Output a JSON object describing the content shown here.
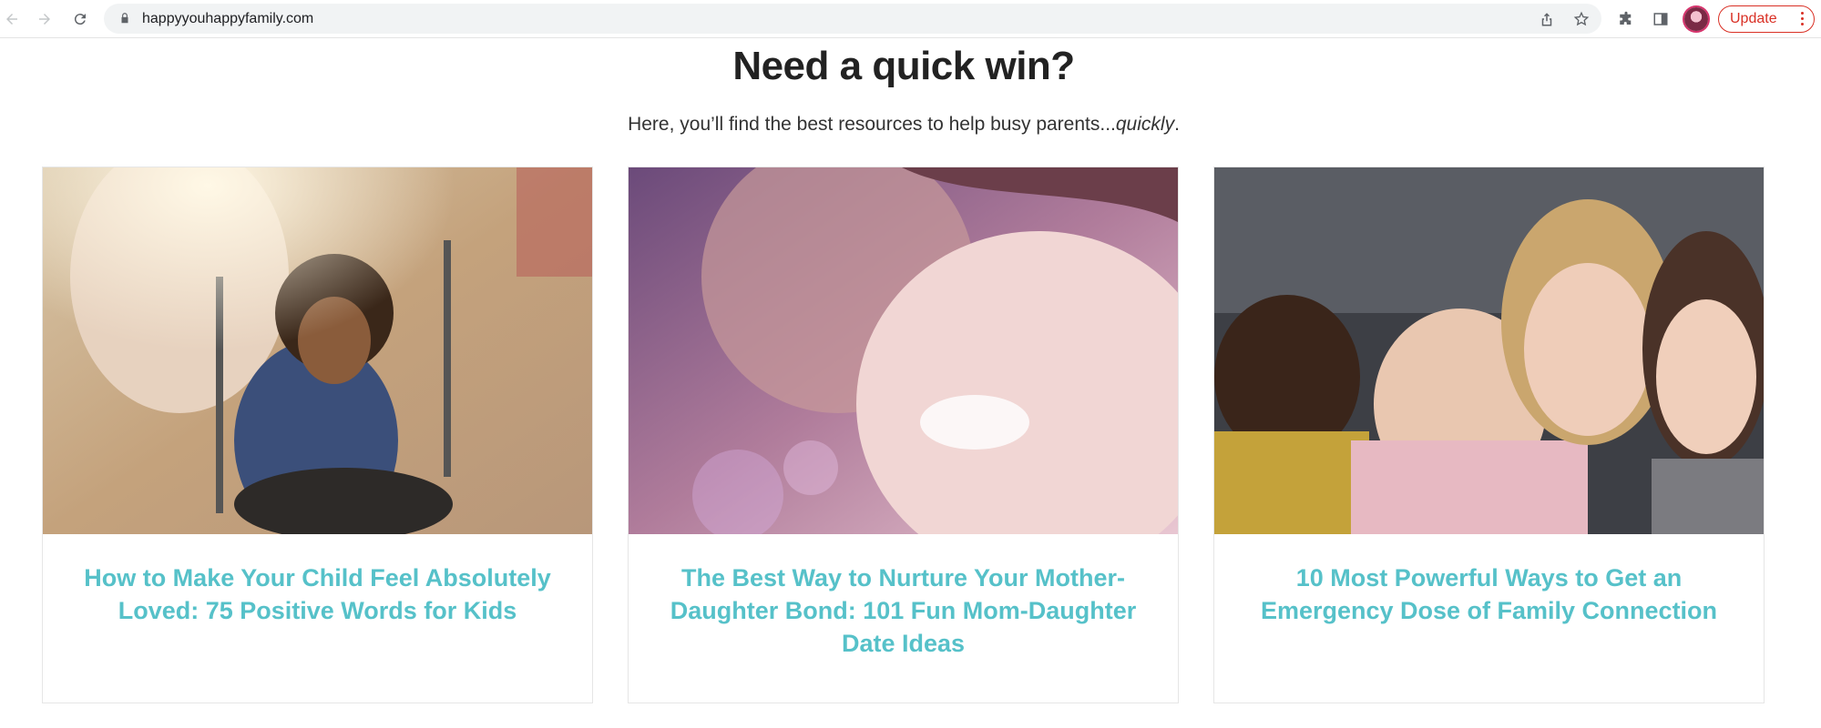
{
  "browser": {
    "url": "happyyouhappyfamily.com",
    "update_label": "Update"
  },
  "section": {
    "title": "Need a quick win?",
    "subtitle_prefix": "Here, you’ll find the best resources to help busy parents...",
    "subtitle_emphasis": "quickly",
    "subtitle_suffix": "."
  },
  "cards": [
    {
      "title": "How to Make Your Child Feel Absolutely Loved: 75 Positive Words for Kids"
    },
    {
      "title": "The Best Way to Nurture Your Mother-Daughter Bond: 101 Fun Mom-Daughter Date Ideas"
    },
    {
      "title": "10 Most Powerful Ways to Get an Emergency Dose of Family Connection"
    }
  ],
  "colors": {
    "link_teal": "#56c1c9",
    "update_red": "#d93025"
  }
}
